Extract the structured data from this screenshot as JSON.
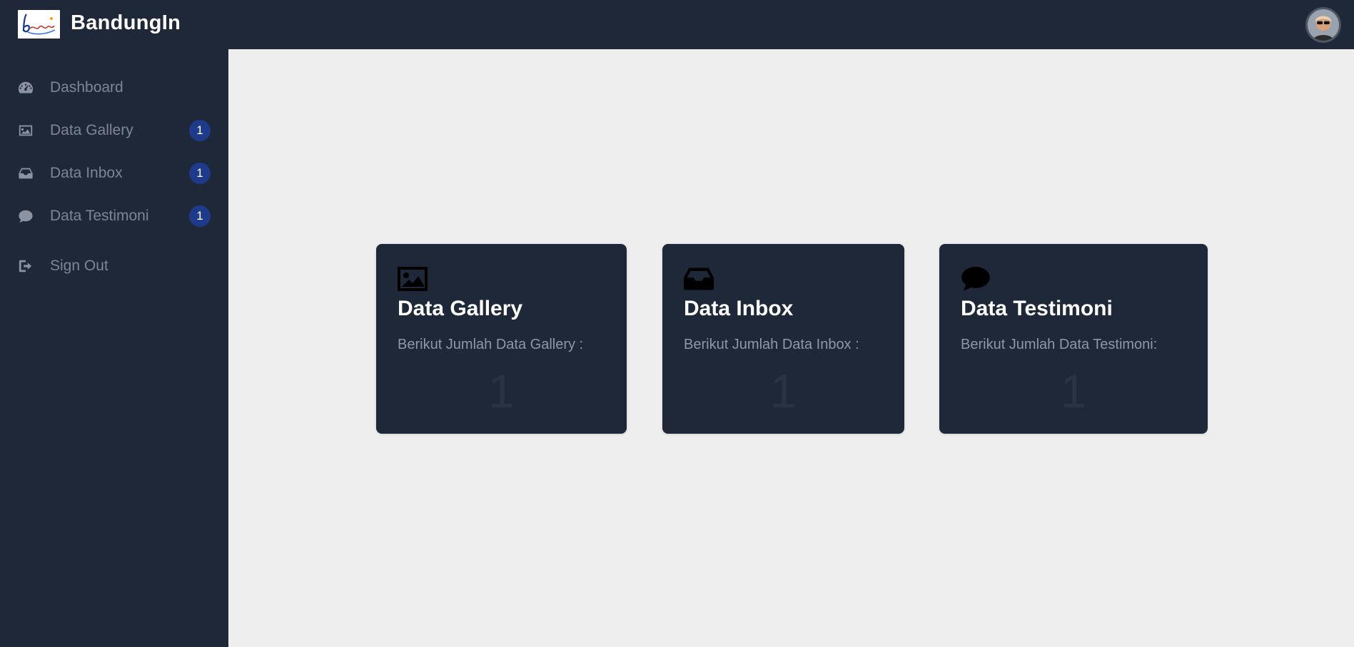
{
  "header": {
    "brand_name": "BandungIn",
    "logo_text": "bandung",
    "avatar_icon": "user-avatar"
  },
  "sidebar": {
    "items": [
      {
        "label": "Dashboard",
        "icon": "dashboard-icon",
        "badge": null
      },
      {
        "label": "Data Gallery",
        "icon": "image-icon",
        "badge": "1"
      },
      {
        "label": "Data Inbox",
        "icon": "inbox-icon",
        "badge": "1"
      },
      {
        "label": "Data Testimoni",
        "icon": "comment-icon",
        "badge": "1"
      },
      {
        "label": "Sign Out",
        "icon": "sign-out-icon",
        "badge": null
      }
    ]
  },
  "cards": [
    {
      "title": "Data Gallery",
      "description": "Berikut Jumlah Data Gallery :",
      "count": "1",
      "icon": "image-icon"
    },
    {
      "title": "Data Inbox",
      "description": "Berikut Jumlah Data Inbox :",
      "count": "1",
      "icon": "inbox-icon"
    },
    {
      "title": "Data Testimoni",
      "description": "Berikut Jumlah Data Testimoni:",
      "count": "1",
      "icon": "comment-icon"
    }
  ],
  "colors": {
    "sidebar_bg": "#1f2838",
    "content_bg": "#eeeeee",
    "badge_bg": "#1e3a8a",
    "nav_text": "#7e8694"
  }
}
